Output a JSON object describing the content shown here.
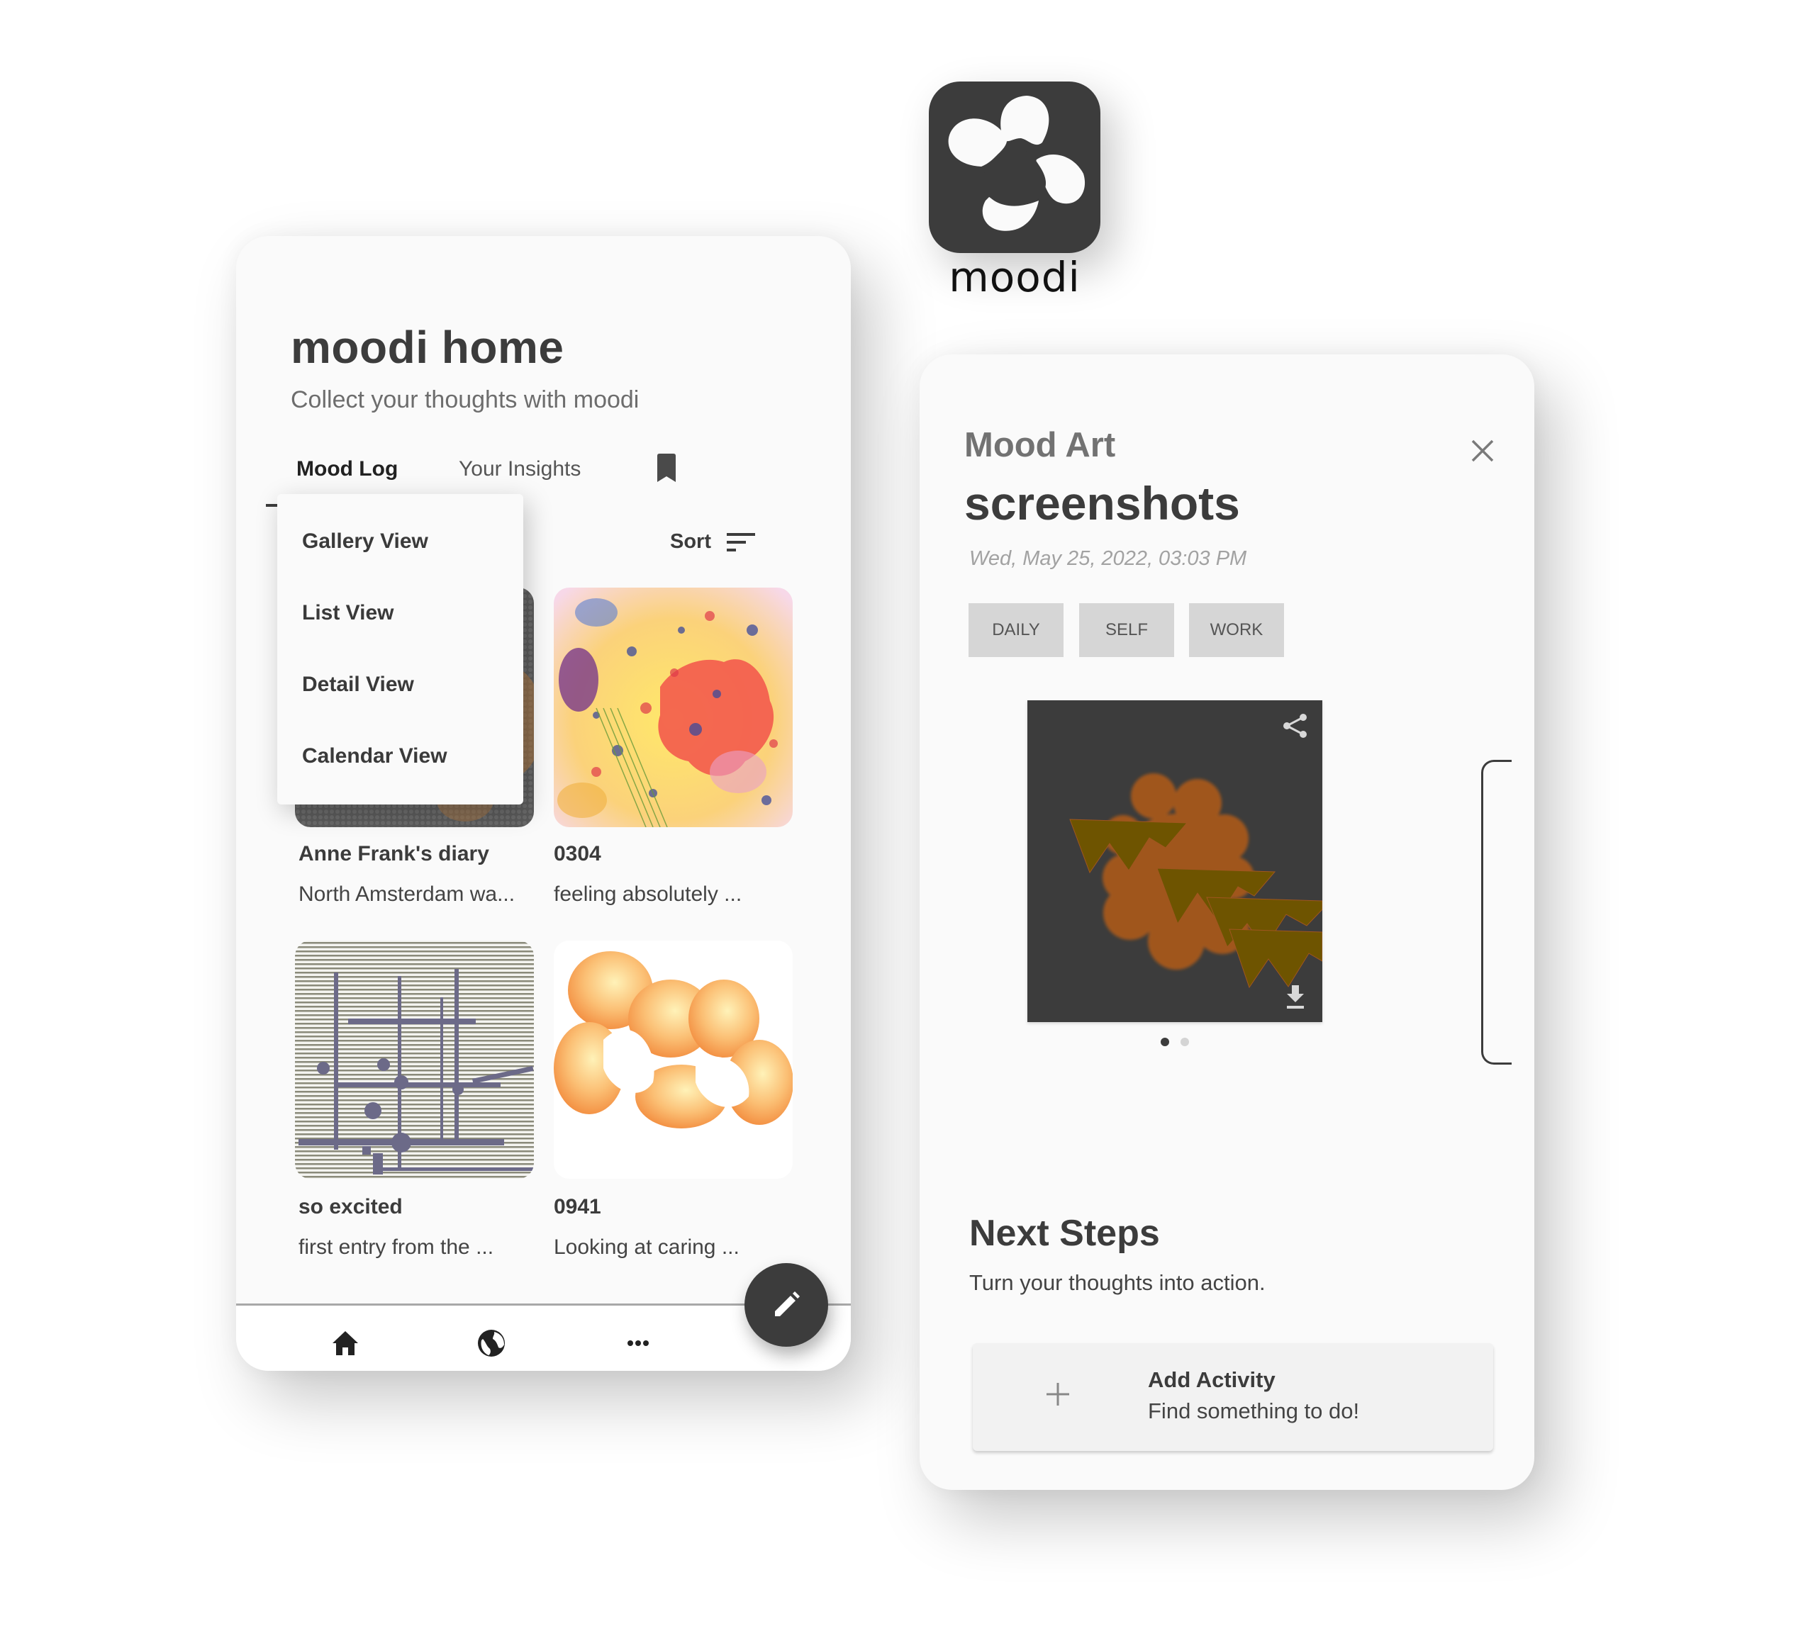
{
  "brand": {
    "name": "moodi",
    "logo_icon": "flower-blob-icon",
    "colors": {
      "dark": "#3c3c3c",
      "panel_bg": "#fafafa",
      "tag_bg": "#d6d6d6",
      "text_muted": "#a2a2a2"
    }
  },
  "home": {
    "title": "moodi home",
    "subtitle": "Collect your thoughts with moodi",
    "tabs": [
      {
        "label": "Mood Log",
        "active": true
      },
      {
        "label": "Your Insights",
        "active": false
      },
      {
        "label": "",
        "icon": "bookmark-icon",
        "active": false
      }
    ],
    "view_menu": {
      "open": true,
      "items": [
        {
          "label": "Gallery View"
        },
        {
          "label": "List View"
        },
        {
          "label": "Detail View"
        },
        {
          "label": "Calendar View"
        }
      ]
    },
    "sort_label": "Sort",
    "sort_icon": "sort-lines-icon",
    "entries": [
      {
        "title": "Anne Frank's diary",
        "preview": "North Amsterdam wa..."
      },
      {
        "title": "0304",
        "preview": "feeling absolutely ..."
      },
      {
        "title": "so excited",
        "preview": "first entry from the ..."
      },
      {
        "title": "0941",
        "preview": "Looking at caring ..."
      }
    ],
    "bottom_nav": [
      {
        "icon": "home-icon",
        "active": true
      },
      {
        "icon": "globe-icon",
        "active": false
      },
      {
        "icon": "more-horizontal-icon",
        "active": false
      }
    ],
    "fab_icon": "pencil-icon"
  },
  "detail": {
    "section_label": "Mood Art",
    "title": "screenshots",
    "date": "Wed, May 25, 2022, 03:03 PM",
    "tags": [
      "DAILY",
      "SELF",
      "WORK"
    ],
    "art_actions": {
      "share_icon": "share-icon",
      "download_icon": "download-icon"
    },
    "carousel": {
      "current": 1,
      "total": 2
    },
    "next_steps": {
      "title": "Next Steps",
      "subtitle": "Turn your thoughts into action.",
      "action": {
        "icon": "plus-icon",
        "title": "Add Activity",
        "subtitle": "Find something to do!"
      }
    },
    "close_icon": "close-icon"
  }
}
